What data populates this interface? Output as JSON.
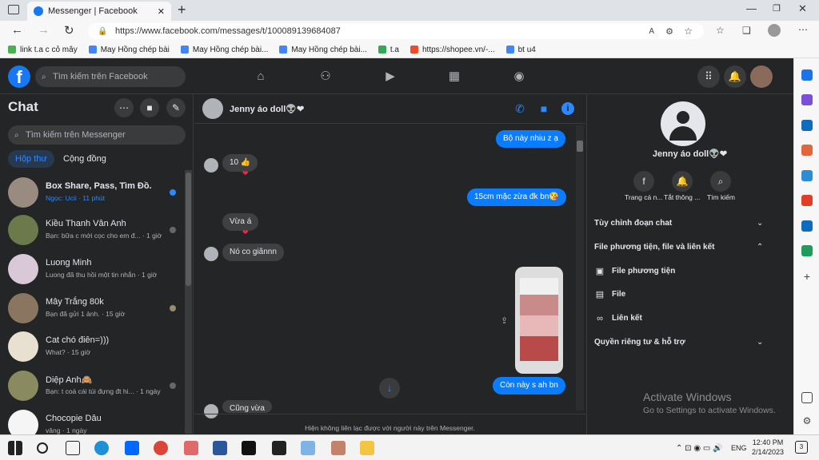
{
  "browser": {
    "tab_title": "Messenger | Facebook",
    "url": "https://www.facebook.com/messages/t/100089139684087",
    "bookmarks": [
      "link t.a c cỏ mây",
      "May Hồng chép bài",
      "May Hồng chép bài...",
      "May Hồng chép bài...",
      "t.a",
      "https://shopee.vn/-...",
      "bt u4"
    ]
  },
  "fb": {
    "logo": "f",
    "search_placeholder": "Tìm kiếm trên Facebook"
  },
  "left": {
    "title": "Chat",
    "search_placeholder": "Tìm kiếm trên Messenger",
    "tab_inbox": "Hộp thư",
    "tab_community": "Cộng đồng",
    "conversations": [
      {
        "name": "Box Share, Pass, Tìm Đồ.",
        "preview": "Ngọc: Ucii · 11 phút"
      },
      {
        "name": "Kiều Thanh Vân Anh",
        "preview": "Bạn: bữa c mới cọc cho em đ... · 1 giờ"
      },
      {
        "name": "Luong Minh",
        "preview": "Luong đã thu hồi một tin nhắn · 1 giờ"
      },
      {
        "name": "Mây Trắng 80k",
        "preview": "Bạn đã gửi 1 ảnh. · 15 giờ"
      },
      {
        "name": "Cat chó điên=)))",
        "preview": "What? · 15 giờ"
      },
      {
        "name": "Diệp Anh🙈",
        "preview": "Bạn: t coá cái túi đựng đt hi... · 1 ngày"
      },
      {
        "name": "Chocopie Dâu",
        "preview": "vâng · 1 ngày"
      }
    ]
  },
  "chat": {
    "contact_name": "Jenny áo doll👽❤",
    "messages": [
      {
        "dir": "out",
        "text": "Bộ này nhiu z ạ"
      },
      {
        "dir": "in",
        "text": "10 👍"
      },
      {
        "dir": "out",
        "text": "15cm mặc zừa đk bn😘"
      },
      {
        "dir": "in",
        "text": "Vừa á"
      },
      {
        "dir": "in",
        "text": "Nó co giãnnn"
      },
      {
        "dir": "out",
        "text": "Còn này s ah bn"
      },
      {
        "dir": "in",
        "text": "Cũng vừa"
      }
    ],
    "footer": "Hiện không liên lạc được với người này trên Messenger."
  },
  "info": {
    "name": "Jenny áo doll👽❤",
    "actions": [
      "Trang cá n...",
      "Tắt thông ...",
      "Tìm kiếm"
    ],
    "sections": [
      "Tùy chỉnh đoạn chat",
      "File phương tiện, file và liên kết",
      "Quyền riêng tư & hỗ trợ"
    ],
    "media_items": [
      "File phương tiện",
      "File",
      "Liên kết"
    ]
  },
  "watermark": {
    "line1": "Activate Windows",
    "line2": "Go to Settings to activate Windows."
  },
  "taskbar": {
    "lang": "ENG",
    "time": "12:40 PM",
    "date": "2/14/2023",
    "notif": "3"
  }
}
